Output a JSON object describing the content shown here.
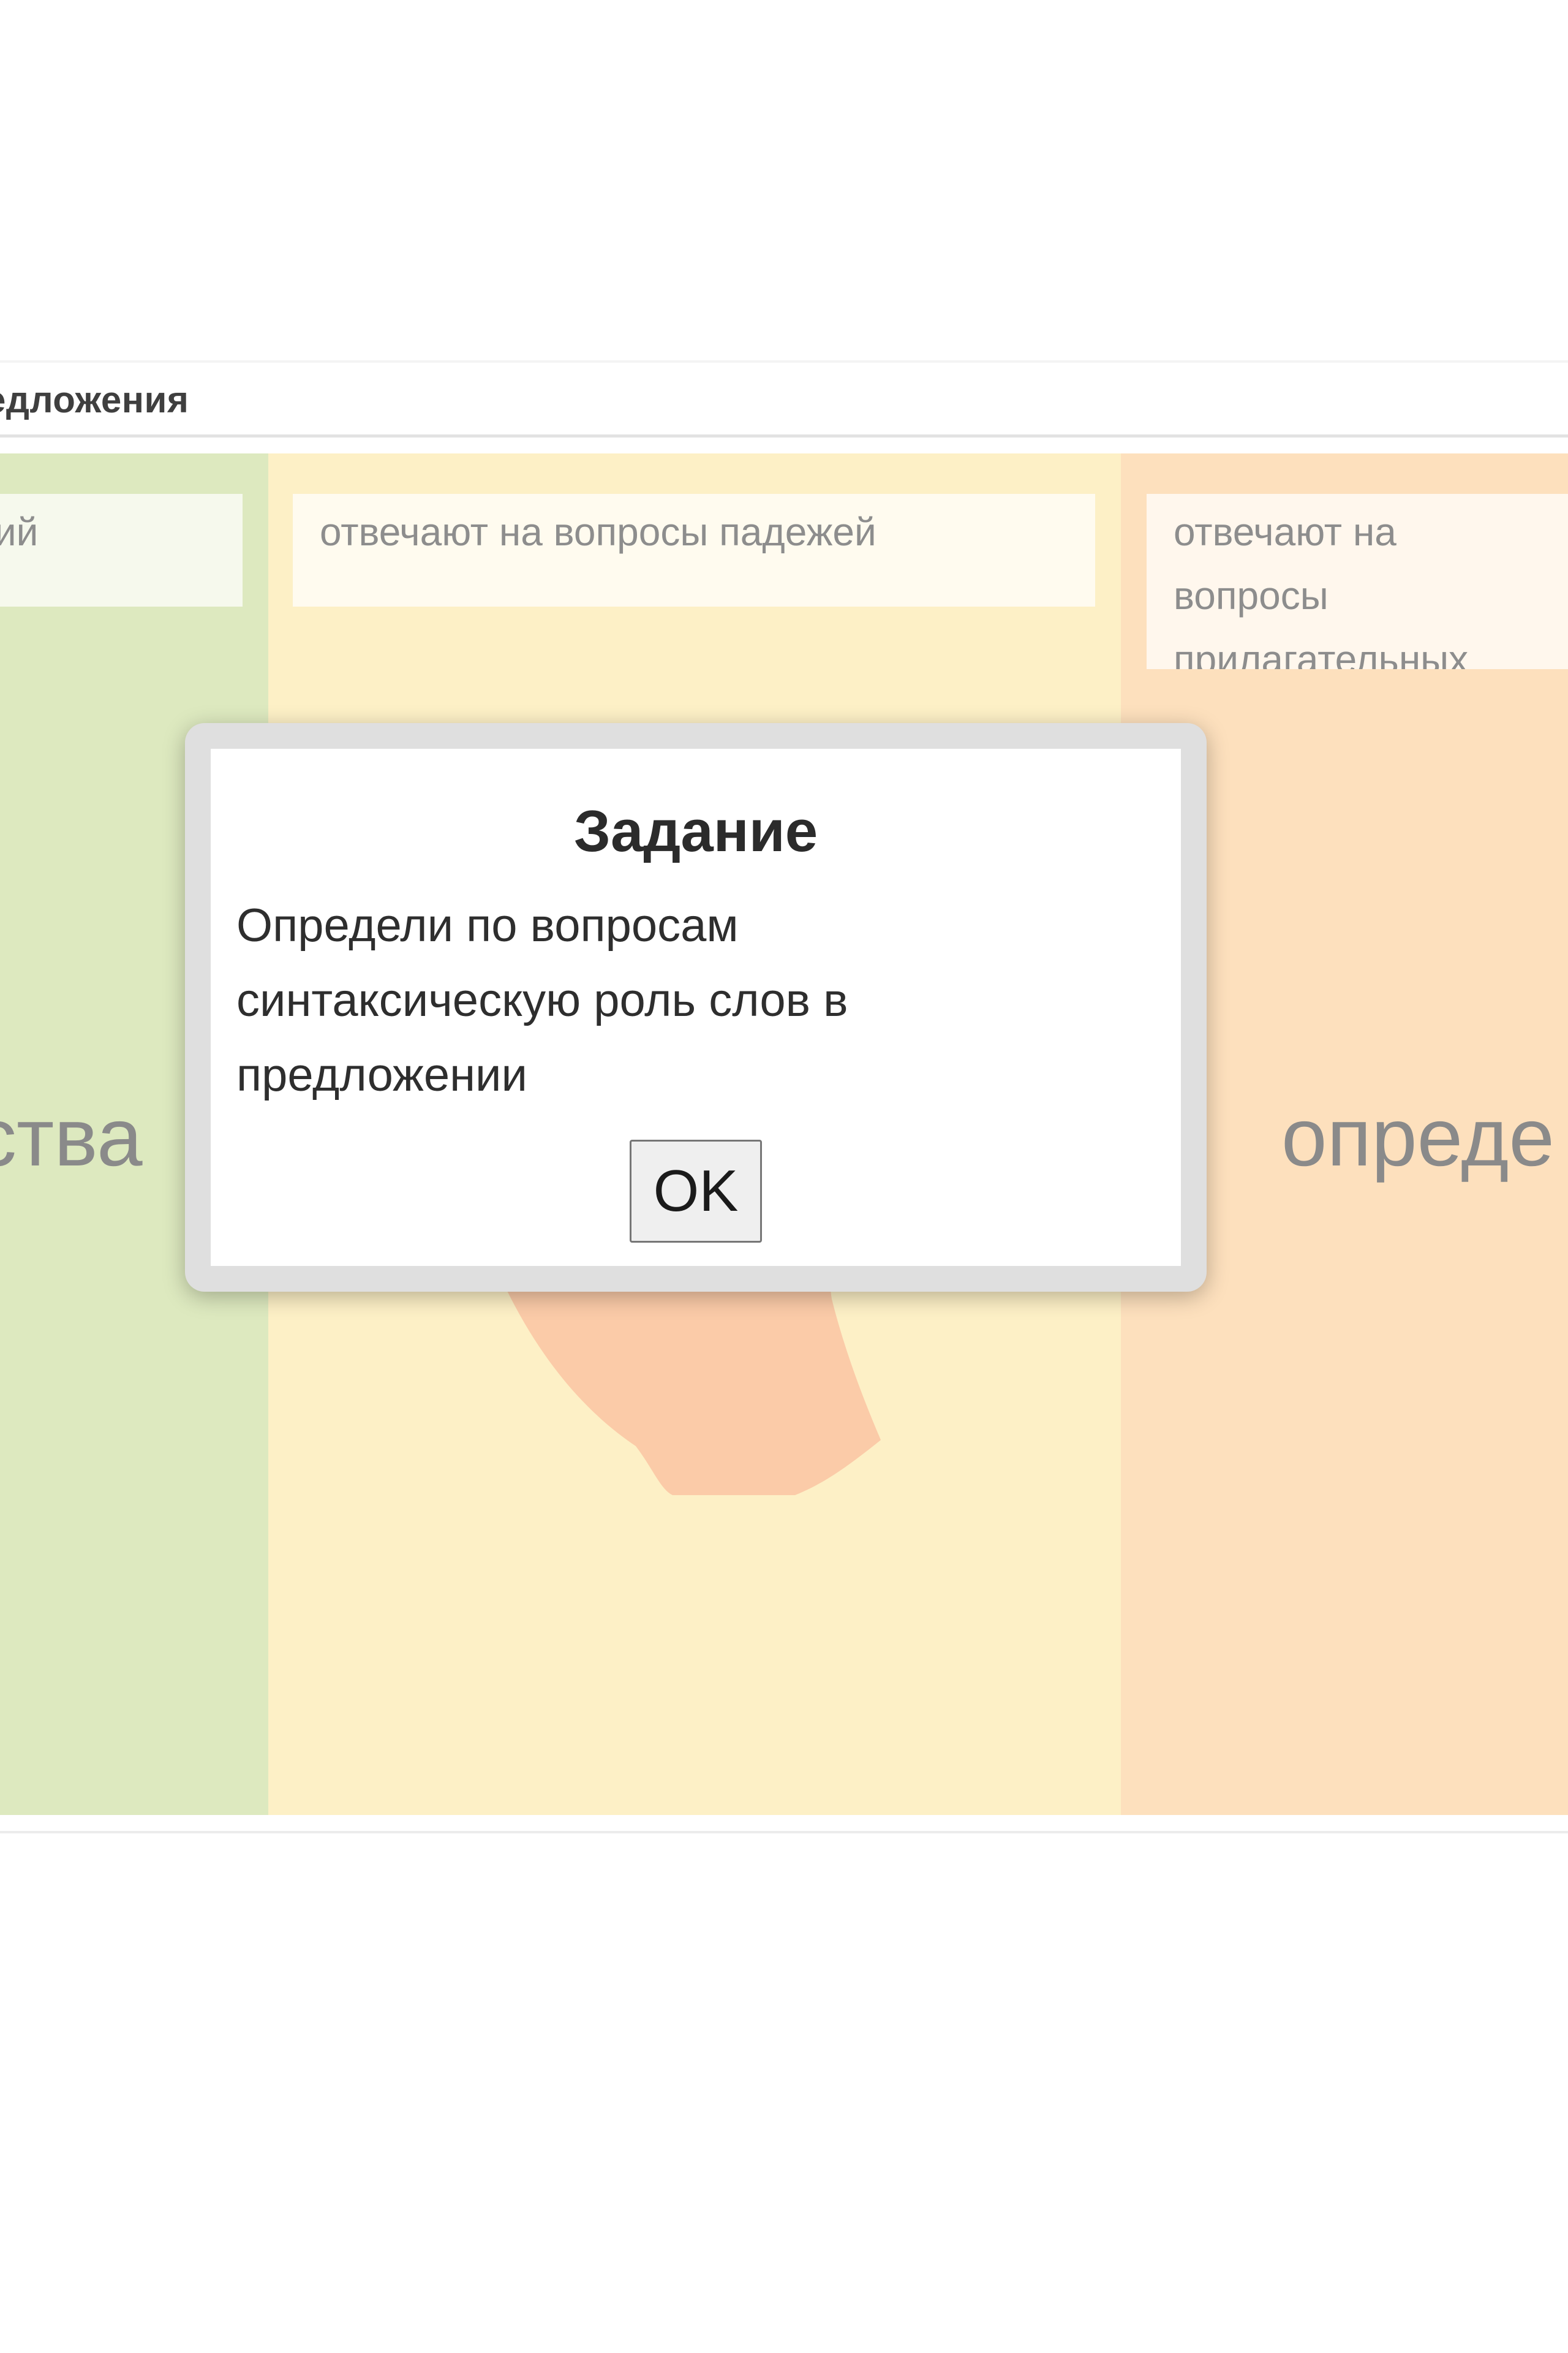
{
  "app": {
    "title": "едложения"
  },
  "columns": [
    {
      "id": "green",
      "card_text": "ечий",
      "big_word": "ства",
      "color": "#dde9bf"
    },
    {
      "id": "yellow",
      "card_text": "отвечают на вопросы падежей",
      "big_word": "",
      "color": "#fdf0c6"
    },
    {
      "id": "orange",
      "card_text": "отвечают на вопросы прилагательных",
      "big_word": "опреде",
      "color": "#fde0bd"
    }
  ],
  "modal": {
    "title": "Задание",
    "body": "Определи по вопросам синтаксическую роль слов в предложении",
    "ok_label": "OK"
  },
  "colors": {
    "modal_frame": "#dfdfdf",
    "blob": "#fbcba8"
  }
}
